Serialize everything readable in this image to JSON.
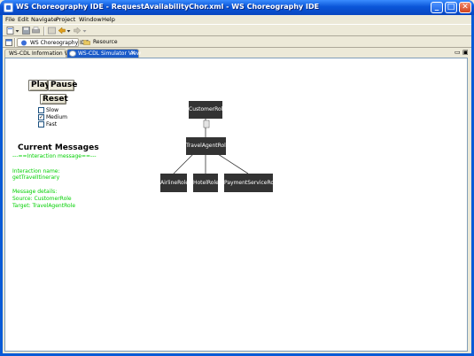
{
  "window": {
    "title": "WS Choreography IDE - RequestAvailabilityChor.xml - WS Choreography IDE",
    "min_glyph": "_",
    "max_glyph": "□",
    "close_glyph": "✕"
  },
  "menu": [
    "File",
    "Edit",
    "Navigate",
    "Project",
    "Window",
    "Help"
  ],
  "perspectives": {
    "choreography": "WS Choreography IDE",
    "resource": "Resource"
  },
  "tabs": {
    "info": "WS-CDL Information View",
    "sim": "WS-CDL Simulator View",
    "close_glyph": "✕"
  },
  "view_controls": {
    "minimize_glyph": "▭",
    "maximize_glyph": "▣"
  },
  "controls": {
    "play": "Play",
    "pause": "Pause",
    "reset": "Reset",
    "speeds": [
      {
        "label": "Slow",
        "checked": false
      },
      {
        "label": "Medium",
        "checked": true
      },
      {
        "label": "Fast",
        "checked": false
      }
    ],
    "check_glyph": "✓"
  },
  "messages": {
    "heading": "Current Messages",
    "divider": "---==Interaction message==---",
    "interaction_label": "Interaction name:",
    "interaction_value": "getTravelItinerary",
    "details_label": "Message details:",
    "source": "Source: CustomerRole",
    "target": "Target: TravelAgentRole"
  },
  "diagram": {
    "nodes": {
      "customer": "CustomerRole",
      "travel_agent": "TravelAgentRole",
      "airline": "AirlineRole",
      "hotel": "HotelRole",
      "payment": "PaymentServiceRole"
    }
  },
  "colors": {
    "title_blue": "#0a55d8",
    "message_green": "#00d000",
    "node_fill": "#333333"
  }
}
